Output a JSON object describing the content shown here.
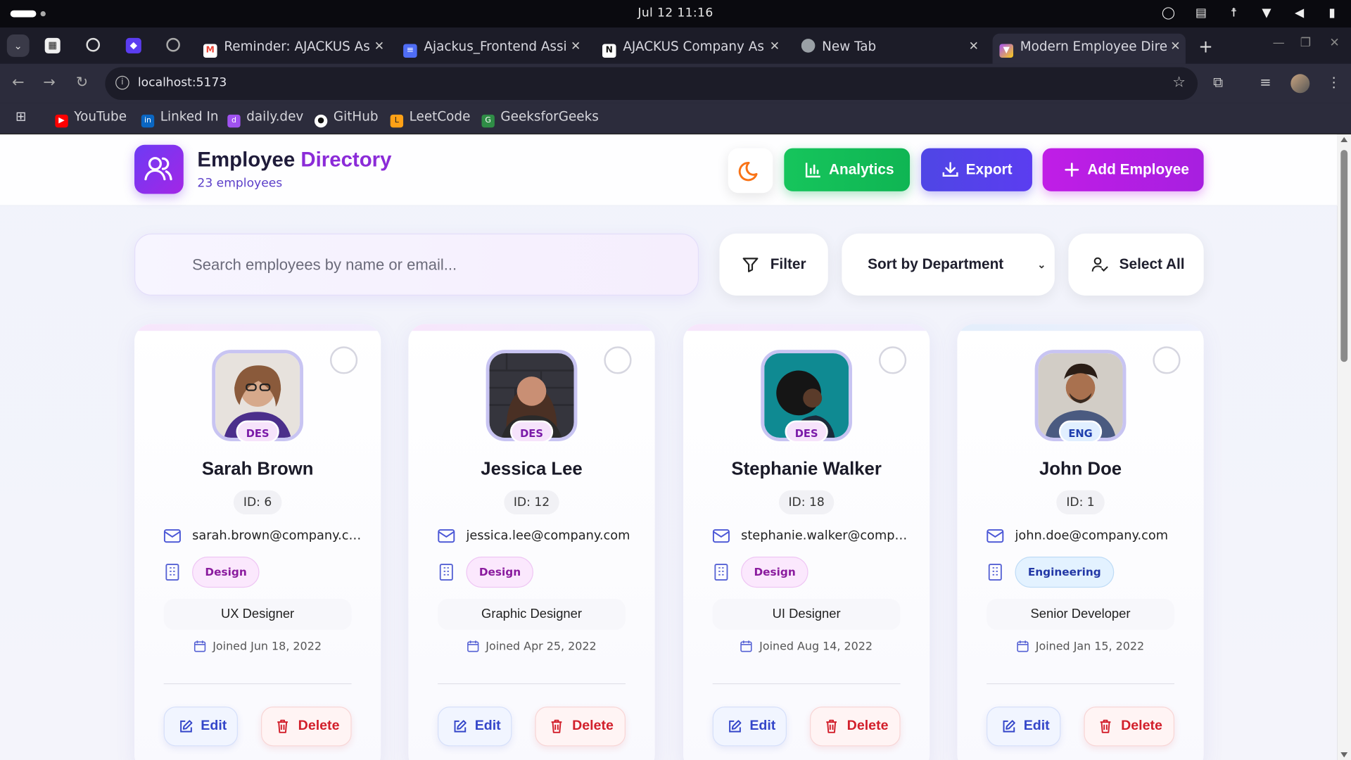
{
  "os": {
    "clock": "Jul 12  11:16"
  },
  "browser": {
    "tabs": [
      {
        "title": "Reminder: AJACKUS As",
        "icon": "gmail-icon",
        "color": "#ea4335"
      },
      {
        "title": "Ajackus_Frontend Assi",
        "icon": "docs-icon",
        "color": "#4f6df5"
      },
      {
        "title": "AJACKUS Company As",
        "icon": "notion-icon",
        "color": "#ffffff"
      },
      {
        "title": "New Tab",
        "icon": "chrome-icon",
        "color": "#9aa0a6"
      },
      {
        "title": "Modern Employee Dire",
        "icon": "vite-icon",
        "color": "#a855f7"
      }
    ],
    "url": "localhost:5173",
    "bookmarks": [
      {
        "label": "YouTube",
        "icon": "youtube-icon",
        "color": "#ff0000"
      },
      {
        "label": "Linked In",
        "icon": "linkedin-icon",
        "color": "#0a66c2"
      },
      {
        "label": "daily.dev",
        "icon": "dailydev-icon",
        "color": "#a052f0"
      },
      {
        "label": "GitHub",
        "icon": "github-icon",
        "color": "#ffffff"
      },
      {
        "label": "LeetCode",
        "icon": "leetcode-icon",
        "color": "#ffa116"
      },
      {
        "label": "GeeksforGeeks",
        "icon": "gfg-icon",
        "color": "#2f8d46"
      }
    ]
  },
  "header": {
    "title_part1": "Employee ",
    "title_part2": "Directory",
    "subtitle": "23 employees",
    "analytics_label": "Analytics",
    "export_label": "Export",
    "add_label": "Add Employee"
  },
  "controls": {
    "search_placeholder": "Search employees by name or email...",
    "filter_label": "Filter",
    "sort_label": "Sort by Department",
    "select_all_label": "Select All"
  },
  "employees": [
    {
      "name": "Sarah Brown",
      "id": "ID: 6",
      "email": "sarah.brown@company.com",
      "department": "Design",
      "badge": "DES",
      "role": "UX Designer",
      "joined": "Joined Jun 18, 2022",
      "photo_colors": [
        "#c79a7a",
        "#4b2f6b"
      ]
    },
    {
      "name": "Jessica Lee",
      "id": "ID: 12",
      "email": "jessica.lee@company.com",
      "department": "Design",
      "badge": "DES",
      "role": "Graphic Designer",
      "joined": "Joined Apr 25, 2022",
      "photo_colors": [
        "#b07b62",
        "#3a3340"
      ]
    },
    {
      "name": "Stephanie Walker",
      "id": "ID: 18",
      "email": "stephanie.walker@compa...",
      "department": "Design",
      "badge": "DES",
      "role": "UI Designer",
      "joined": "Joined Aug 14, 2022",
      "photo_colors": [
        "#0f8a92",
        "#1a2230"
      ]
    },
    {
      "name": "John Doe",
      "id": "ID: 1",
      "email": "john.doe@company.com",
      "department": "Engineering",
      "badge": "ENG",
      "role": "Senior Developer",
      "joined": "Joined Jan 15, 2022",
      "photo_colors": [
        "#c9c4bd",
        "#4a5a80"
      ]
    }
  ],
  "card_labels": {
    "edit": "Edit",
    "delete": "Delete"
  }
}
